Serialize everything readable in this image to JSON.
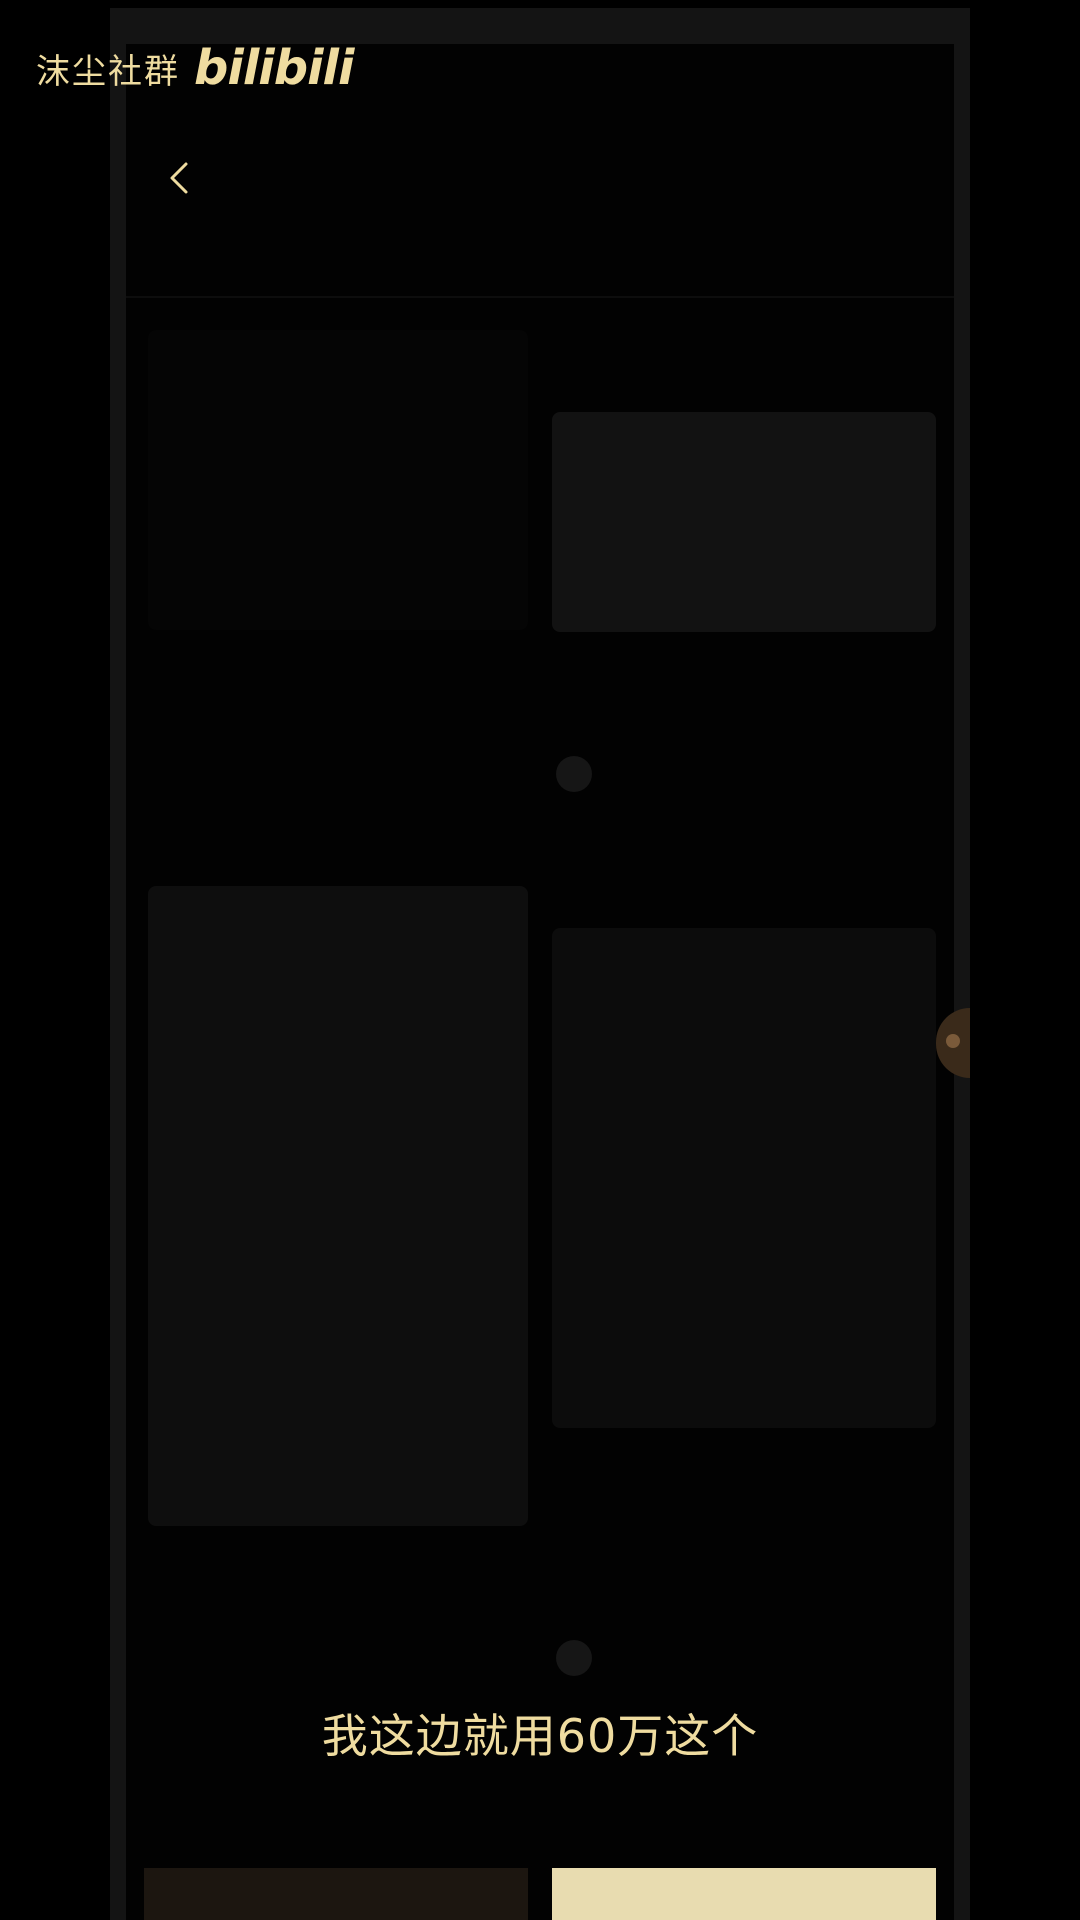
{
  "watermark": {
    "channel": "沫尘社群",
    "logo": "bilibili"
  },
  "header": {
    "back_icon": "chevron-left-icon"
  },
  "subtitle": "我这边就用60万这个",
  "colors": {
    "accent": "#efdca0",
    "background": "#000000"
  }
}
